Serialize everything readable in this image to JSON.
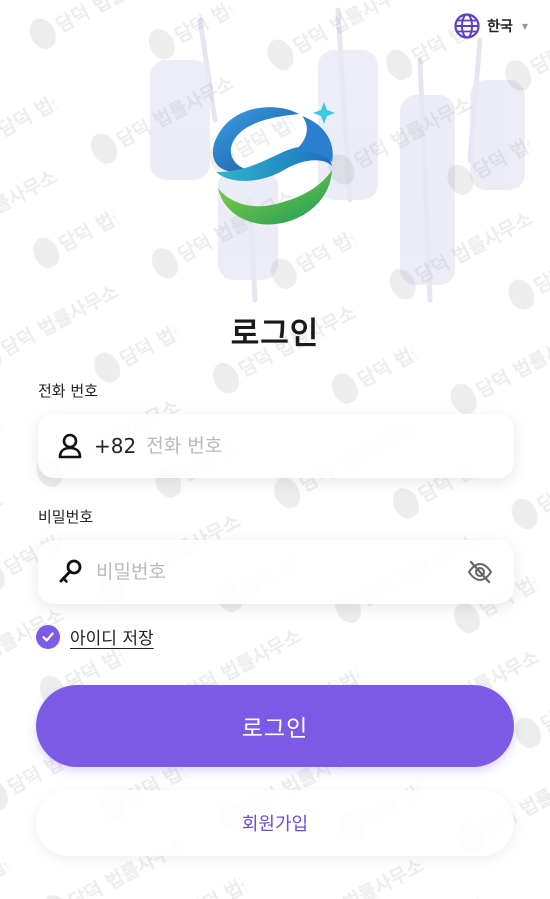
{
  "language": {
    "label": "한국",
    "icon": "globe-icon"
  },
  "page_title": "로그인",
  "phone": {
    "label": "전화 번호",
    "prefix": "+82",
    "placeholder": "전화 번호",
    "value": "",
    "icon": "user-icon"
  },
  "password": {
    "label": "비밀번호",
    "placeholder": "비밀번호",
    "value": "",
    "icon": "key-icon",
    "toggle_icon": "eye-off-icon"
  },
  "remember": {
    "label": "아이디 저장",
    "checked": true
  },
  "login_button": "로그인",
  "signup_button": "회원가입",
  "watermark": {
    "text": "담덕 법률사무소"
  },
  "colors": {
    "accent": "#7b5be6",
    "signup_text": "#6b4fd6",
    "logo_blue": "#1f6fc5",
    "logo_green": "#3cb35a"
  }
}
